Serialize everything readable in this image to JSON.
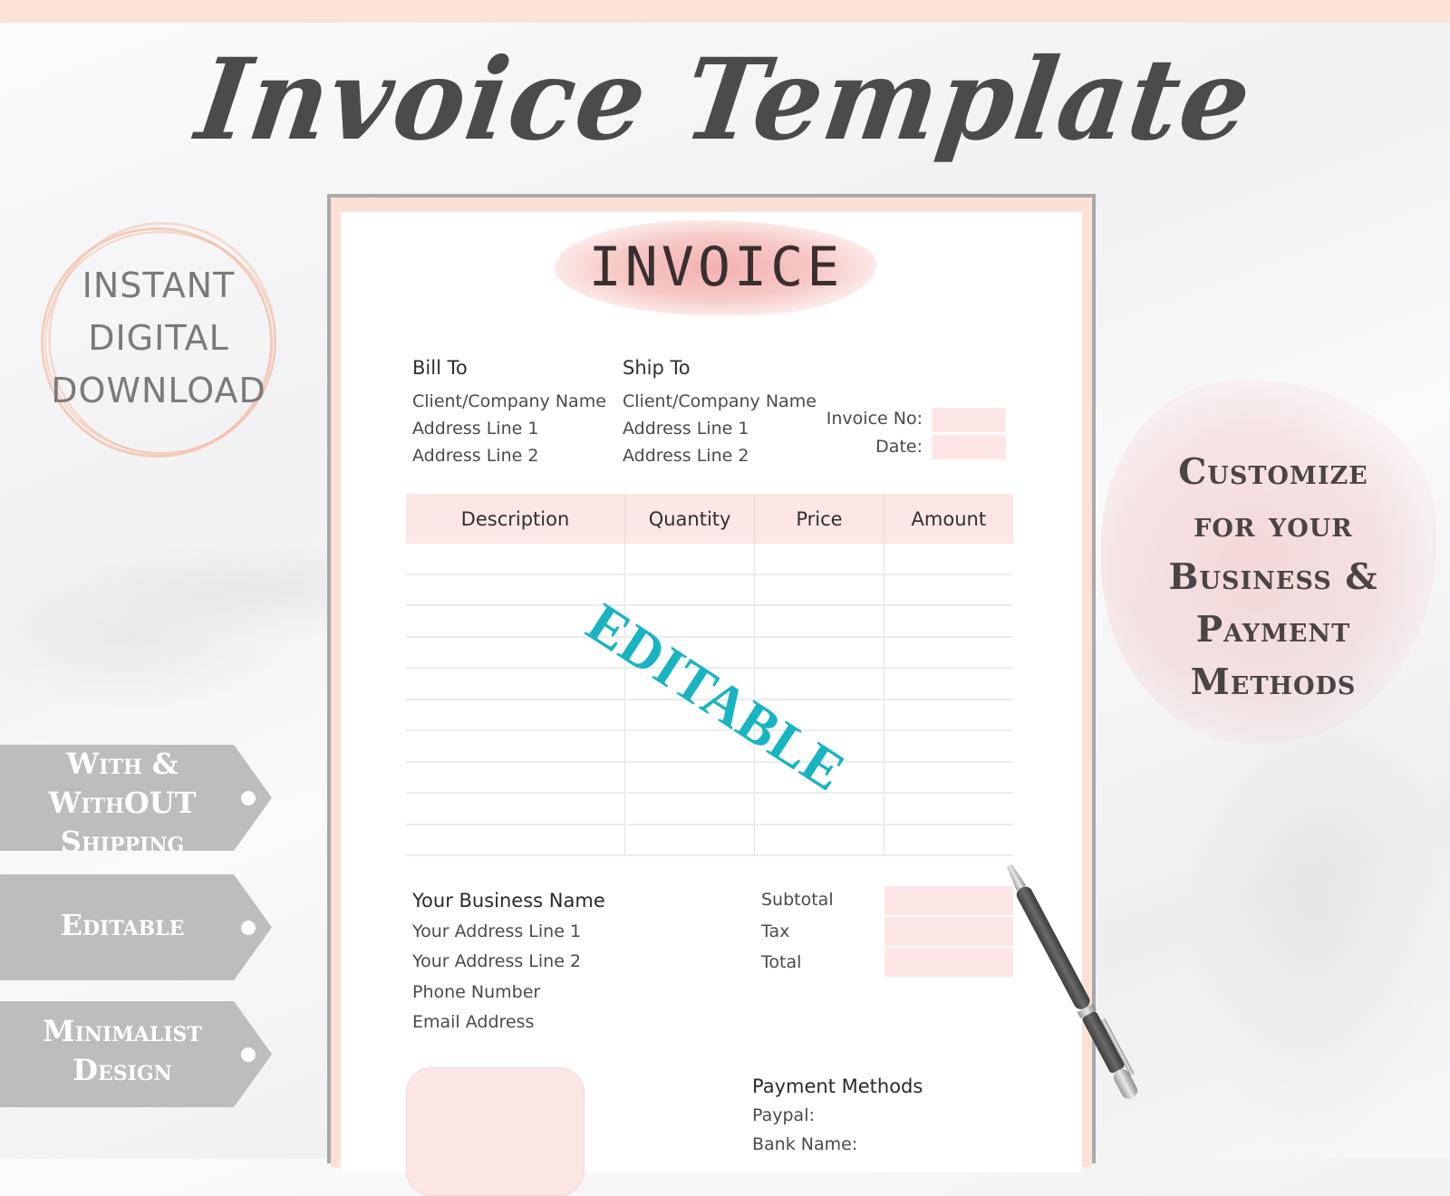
{
  "banner": {
    "title": "Invoice Template",
    "badge_lines": [
      "INSTANT",
      "DIGITAL",
      "DOWNLOAD"
    ],
    "customize_lines": [
      "Customize",
      "for your",
      "Business &",
      "Payment",
      "Methods"
    ],
    "tags": [
      {
        "lines": [
          "With &",
          "WithOUT",
          "Shipping"
        ]
      },
      {
        "lines": [
          "Editable"
        ]
      },
      {
        "lines": [
          "Minimalist",
          "Design"
        ]
      }
    ],
    "stamp": "EDITABLE",
    "colors": {
      "accent_peach": "#fde0d5",
      "accent_pink": "#fde6e6",
      "tag_gray": "#bdbdbd",
      "stamp_teal": "#19b4c2",
      "title_gray": "#4b4b4b"
    }
  },
  "invoice": {
    "heading": "INVOICE",
    "bill_to": {
      "label": "Bill To",
      "lines": [
        "Client/Company Name",
        "Address Line 1",
        "Address Line 2"
      ]
    },
    "ship_to": {
      "label": "Ship To",
      "lines": [
        "Client/Company Name",
        "Address Line 1",
        "Address Line 2"
      ]
    },
    "meta": {
      "invoice_no_label": "Invoice No:",
      "invoice_no_value": "",
      "date_label": "Date:",
      "date_value": ""
    },
    "table": {
      "columns": [
        "Description",
        "Quantity",
        "Price",
        "Amount"
      ],
      "rows": [
        [
          "",
          "",
          "",
          ""
        ],
        [
          "",
          "",
          "",
          ""
        ],
        [
          "",
          "",
          "",
          ""
        ],
        [
          "",
          "",
          "",
          ""
        ],
        [
          "",
          "",
          "",
          ""
        ],
        [
          "",
          "",
          "",
          ""
        ],
        [
          "",
          "",
          "",
          ""
        ],
        [
          "",
          "",
          "",
          ""
        ],
        [
          "",
          "",
          "",
          ""
        ],
        [
          "",
          "",
          "",
          ""
        ]
      ]
    },
    "business": {
      "name": "Your Business Name",
      "lines": [
        "Your Address Line 1",
        "Your Address Line 2",
        "Phone Number",
        "Email Address"
      ]
    },
    "totals": {
      "subtotal_label": "Subtotal",
      "tax_label": "Tax",
      "total_label": "Total",
      "subtotal_value": "",
      "tax_value": "",
      "total_value": ""
    },
    "payment": {
      "label": "Payment Methods",
      "lines": [
        "Paypal:",
        "Bank Name:"
      ]
    }
  }
}
